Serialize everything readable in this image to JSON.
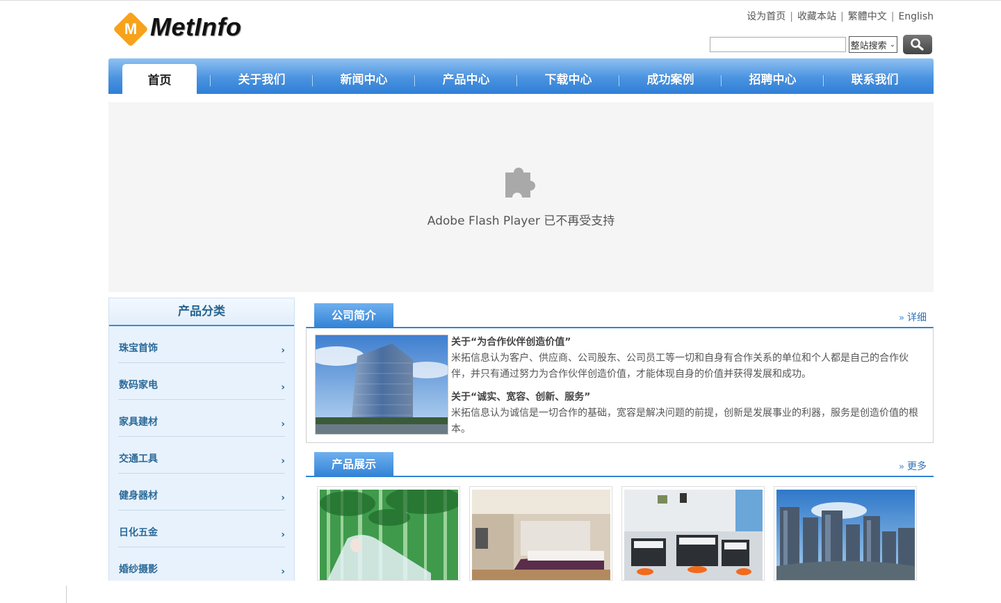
{
  "header": {
    "logo_letter": "M",
    "logo_text": "MetInfo",
    "links": [
      {
        "label": "设为首页"
      },
      {
        "label": "收藏本站"
      },
      {
        "label": "繁體中文"
      },
      {
        "label": "English"
      }
    ],
    "search": {
      "input_value": "",
      "select_value": "整站搜索"
    }
  },
  "nav": {
    "items": [
      {
        "label": "首页",
        "active": true
      },
      {
        "label": "关于我们"
      },
      {
        "label": "新闻中心"
      },
      {
        "label": "产品中心"
      },
      {
        "label": "下载中心"
      },
      {
        "label": "成功案例"
      },
      {
        "label": "招聘中心"
      },
      {
        "label": "联系我们"
      }
    ]
  },
  "flash": {
    "icon": "puzzle-plugin-icon",
    "message": "Adobe Flash Player 已不再受支持"
  },
  "sidebar": {
    "title": "产品分类",
    "items": [
      {
        "label": "珠宝首饰"
      },
      {
        "label": "数码家电"
      },
      {
        "label": "家具建材"
      },
      {
        "label": "交通工具"
      },
      {
        "label": "健身器材"
      },
      {
        "label": "日化五金"
      },
      {
        "label": "婚纱摄影"
      }
    ],
    "chevron": "›"
  },
  "about": {
    "tab": "公司简介",
    "more_arrows": "»",
    "more": "详细",
    "p1_head": "关于“为合作伙伴创造价值”",
    "p1_body": "米拓信息认为客户、供应商、公司股东、公司员工等一切和自身有合作关系的单位和个人都是自己的合作伙伴，并只有通过努力为合作伙伴创造价值，才能体现自身的价值并获得发展和成功。",
    "p2_head": "关于“诚实、宽容、创新、服务”",
    "p2_body": "米拓信息认为诚信是一切合作的基础，宽容是解决问题的前提，创新是发展事业的利器，服务是创造价值的根本。"
  },
  "products": {
    "tab": "产品展示",
    "more_arrows": "»",
    "more": "更多"
  },
  "colors": {
    "nav_blue": "#3584d7",
    "accent_orange": "#f7a21b",
    "sidebar_bg": "#e8f2fc",
    "link_blue": "#2b6a98"
  }
}
